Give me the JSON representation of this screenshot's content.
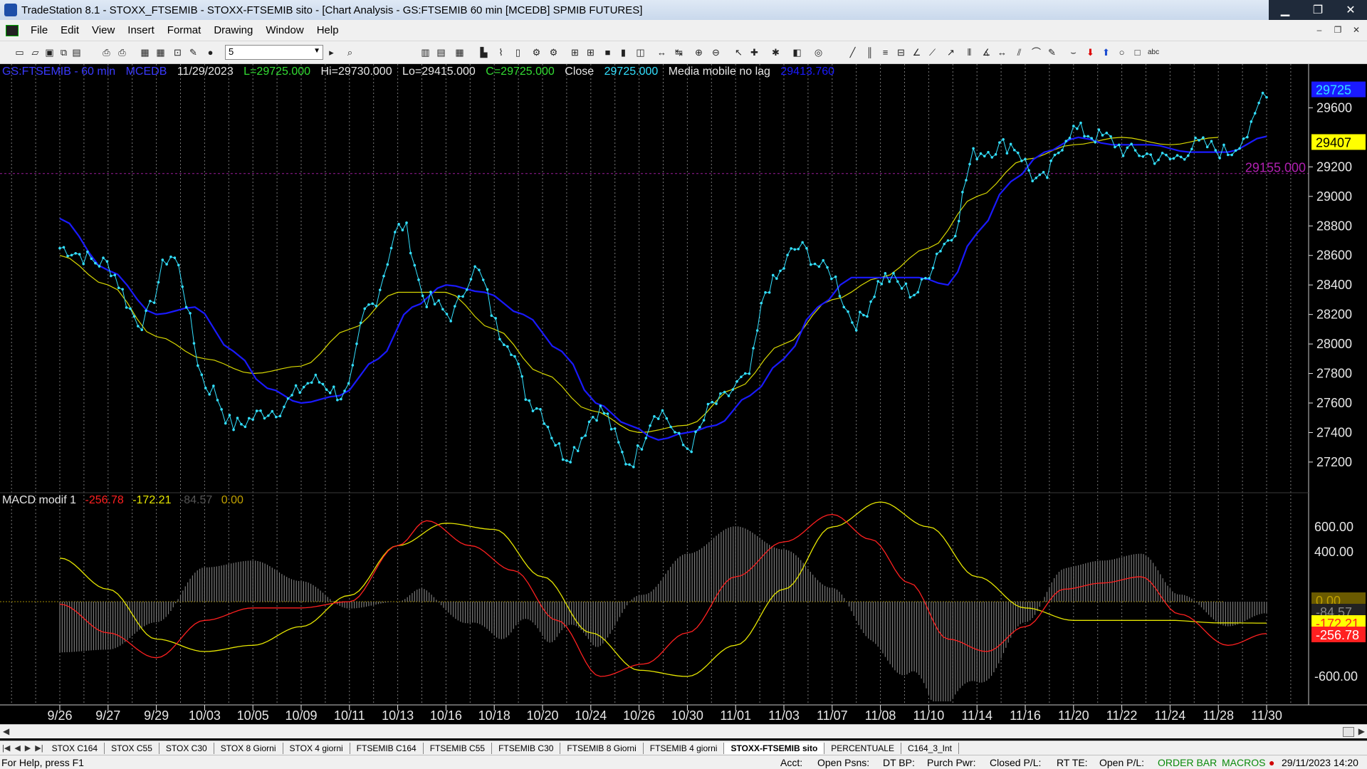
{
  "window": {
    "title": "TradeStation 8.1 - STOXX_FTSEMIB - STOXX-FTSEMIB sito - [Chart Analysis - GS:FTSEMIB  60 min  [MCEDB] SPMIB FUTURES]",
    "minimize": "▁",
    "restore": "❐",
    "close": "✕"
  },
  "menu": {
    "items": [
      "File",
      "Edit",
      "View",
      "Insert",
      "Format",
      "Drawing",
      "Window",
      "Help"
    ]
  },
  "toolbar": {
    "interval_value": "5"
  },
  "chart_header": {
    "symbol": "GS:FTSEMIB - 60 min",
    "exchange": "MCEDB",
    "date": "11/29/2023",
    "last": "L=29725.000",
    "high": "Hi=29730.000",
    "low": "Lo=29415.000",
    "close": "C=29725.000",
    "close_label": "Close",
    "close_value": "29725.000",
    "indicator_name": "Media mobile no lag",
    "indicator_value": "29413.760"
  },
  "macd_header": {
    "name": "MACD modif 1",
    "v1": "-256.78",
    "v2": "-172.21",
    "v3": "-84.57",
    "v4": "0.00"
  },
  "price_axis": {
    "labels": [
      "29600",
      "29200",
      "29000",
      "28800",
      "28600",
      "28400",
      "28200",
      "28000",
      "27800",
      "27600",
      "27400",
      "27200"
    ],
    "last_tag": "29725",
    "ma_tag": "29407",
    "hline_tag": "29155.000"
  },
  "macd_axis": {
    "labels": [
      "600.00",
      "400.00",
      "-600.00"
    ],
    "tags": [
      "0.00",
      "-84.57",
      "-172.21",
      "-256.78"
    ]
  },
  "chart_data": {
    "type": "line",
    "x_labels": [
      "9/26",
      "9/27",
      "9/29",
      "10/03",
      "10/05",
      "10/09",
      "10/11",
      "10/13",
      "10/16",
      "10/18",
      "10/20",
      "10/24",
      "10/26",
      "10/30",
      "11/01",
      "11/03",
      "11/07",
      "11/08",
      "11/10",
      "11/14",
      "11/16",
      "11/20",
      "11/22",
      "11/24",
      "11/28",
      "11/30"
    ],
    "price_series": {
      "name": "Close",
      "color": "#33e0ff",
      "anchors": [
        [
          0,
          28650
        ],
        [
          0.9,
          28550
        ],
        [
          1.7,
          28150
        ],
        [
          2.3,
          28600
        ],
        [
          3.1,
          27700
        ],
        [
          3.6,
          27450
        ],
        [
          4.4,
          27550
        ],
        [
          5.3,
          27750
        ],
        [
          5.9,
          27650
        ],
        [
          6.4,
          28250
        ],
        [
          7.1,
          28800
        ],
        [
          7.6,
          28300
        ],
        [
          8.1,
          28200
        ],
        [
          8.6,
          28500
        ],
        [
          9.2,
          28050
        ],
        [
          9.8,
          27600
        ],
        [
          10.5,
          27250
        ],
        [
          11.2,
          27550
        ],
        [
          11.8,
          27200
        ],
        [
          12.4,
          27550
        ],
        [
          13.0,
          27300
        ],
        [
          13.6,
          27600
        ],
        [
          14.2,
          27750
        ],
        [
          14.7,
          28400
        ],
        [
          15.3,
          28650
        ],
        [
          15.9,
          28500
        ],
        [
          16.5,
          28150
        ],
        [
          17.1,
          28450
        ],
        [
          17.7,
          28350
        ],
        [
          18.4,
          28700
        ],
        [
          19.0,
          29300
        ],
        [
          19.7,
          29350
        ],
        [
          20.3,
          29100
        ],
        [
          21.0,
          29450
        ],
        [
          21.6,
          29400
        ],
        [
          22.2,
          29300
        ],
        [
          23.0,
          29250
        ],
        [
          23.6,
          29350
        ],
        [
          24.2,
          29300
        ],
        [
          24.6,
          29420
        ],
        [
          25.0,
          29725
        ]
      ]
    },
    "ma_blue": {
      "name": "Media mobile no lag",
      "color": "#1a1aff",
      "anchors": [
        [
          0,
          28850
        ],
        [
          1,
          28500
        ],
        [
          2,
          28200
        ],
        [
          2.8,
          28250
        ],
        [
          3.6,
          27950
        ],
        [
          4.3,
          27700
        ],
        [
          5.0,
          27600
        ],
        [
          5.8,
          27650
        ],
        [
          6.6,
          27900
        ],
        [
          7.3,
          28250
        ],
        [
          8.0,
          28400
        ],
        [
          8.8,
          28350
        ],
        [
          9.6,
          28200
        ],
        [
          10.4,
          27950
        ],
        [
          11.1,
          27600
        ],
        [
          11.8,
          27450
        ],
        [
          12.4,
          27350
        ],
        [
          13.0,
          27400
        ],
        [
          13.6,
          27450
        ],
        [
          14.3,
          27650
        ],
        [
          15.0,
          27900
        ],
        [
          15.7,
          28250
        ],
        [
          16.4,
          28450
        ],
        [
          17.1,
          28450
        ],
        [
          17.8,
          28450
        ],
        [
          18.4,
          28400
        ],
        [
          19.0,
          28750
        ],
        [
          19.7,
          29100
        ],
        [
          20.4,
          29300
        ],
        [
          21.1,
          29400
        ],
        [
          21.8,
          29350
        ],
        [
          22.6,
          29350
        ],
        [
          23.4,
          29300
        ],
        [
          24.2,
          29300
        ],
        [
          25.0,
          29407
        ]
      ]
    },
    "ma_yellow": {
      "color": "#d8d800",
      "anchors": [
        [
          0,
          28600
        ],
        [
          1,
          28400
        ],
        [
          2,
          28050
        ],
        [
          3,
          27900
        ],
        [
          4,
          27800
        ],
        [
          5,
          27850
        ],
        [
          6,
          28100
        ],
        [
          7,
          28350
        ],
        [
          8,
          28350
        ],
        [
          9,
          28100
        ],
        [
          10,
          27800
        ],
        [
          11,
          27550
        ],
        [
          12,
          27400
        ],
        [
          13,
          27450
        ],
        [
          14,
          27700
        ],
        [
          15,
          28000
        ],
        [
          16,
          28300
        ],
        [
          17,
          28450
        ],
        [
          18,
          28650
        ],
        [
          19,
          29000
        ],
        [
          20,
          29250
        ],
        [
          21,
          29350
        ],
        [
          22,
          29400
        ],
        [
          23,
          29350
        ],
        [
          24,
          29400
        ]
      ]
    },
    "macd_line": {
      "color": "#ff2020",
      "anchors": [
        [
          0,
          -20
        ],
        [
          1,
          -250
        ],
        [
          2,
          -450
        ],
        [
          3,
          -150
        ],
        [
          4,
          -50
        ],
        [
          5,
          -50
        ],
        [
          6,
          0
        ],
        [
          7,
          450
        ],
        [
          7.6,
          650
        ],
        [
          8.5,
          450
        ],
        [
          9.4,
          250
        ],
        [
          10.3,
          -150
        ],
        [
          11.2,
          -600
        ],
        [
          12.1,
          -500
        ],
        [
          13.0,
          -250
        ],
        [
          14.0,
          200
        ],
        [
          15.0,
          480
        ],
        [
          16.0,
          700
        ],
        [
          16.8,
          500
        ],
        [
          17.6,
          150
        ],
        [
          18.4,
          -300
        ],
        [
          19.2,
          -400
        ],
        [
          20.0,
          -200
        ],
        [
          20.8,
          100
        ],
        [
          21.6,
          150
        ],
        [
          22.4,
          200
        ],
        [
          23.2,
          -100
        ],
        [
          24.2,
          -350
        ],
        [
          25.0,
          -256
        ]
      ]
    },
    "signal_line": {
      "color": "#e6e600",
      "anchors": [
        [
          0,
          350
        ],
        [
          1,
          100
        ],
        [
          2,
          -300
        ],
        [
          3,
          -400
        ],
        [
          4,
          -350
        ],
        [
          5,
          -200
        ],
        [
          6,
          50
        ],
        [
          7,
          450
        ],
        [
          8,
          630
        ],
        [
          9,
          580
        ],
        [
          10,
          200
        ],
        [
          11,
          -250
        ],
        [
          12,
          -550
        ],
        [
          13,
          -600
        ],
        [
          14,
          -350
        ],
        [
          15,
          100
        ],
        [
          16,
          600
        ],
        [
          17,
          800
        ],
        [
          18,
          600
        ],
        [
          19,
          200
        ],
        [
          20,
          -50
        ],
        [
          21,
          -150
        ],
        [
          22,
          -150
        ],
        [
          23,
          -150
        ],
        [
          24,
          -170
        ],
        [
          25,
          -172
        ]
      ]
    },
    "price_ylim": [
      27050,
      29800
    ],
    "macd_ylim": [
      -800,
      800
    ]
  },
  "tabs": [
    "STOX C164",
    "STOX C55",
    "STOX  C30",
    "STOX  8 Giorni",
    "STOX 4 giorni",
    "FTSEMIB C164",
    "FTSEMIB C55",
    "FTSEMIB C30",
    "FTSEMIB  8 Giorni",
    "FTSEMIB  4 giorni",
    "STOXX-FTSEMIB sito",
    "PERCENTUALE",
    "C164_3_Int"
  ],
  "tab_nav": [
    "|◀",
    "◀",
    "▶",
    "▶|"
  ],
  "status": {
    "help": "For Help, press F1",
    "acct": "Acct:",
    "open_psns": "Open Psns:",
    "dt_bp": "DT BP:",
    "purch_pwr": "Purch Pwr:",
    "closed_pl": "Closed P/L:",
    "rt_te": "RT TE:",
    "open_pl": "Open P/L:",
    "order_bar": "ORDER BAR",
    "macros": "MACROS",
    "datetime": "29/11/2023 14:20"
  },
  "colors": {
    "price": "#33e0ff",
    "ma_blue": "#1a1aff",
    "ma_yellow": "#d8d800",
    "macd": "#ff2020",
    "signal": "#e6e600",
    "histogram": "#7a7a7a",
    "hline": "#9a1a9a"
  }
}
